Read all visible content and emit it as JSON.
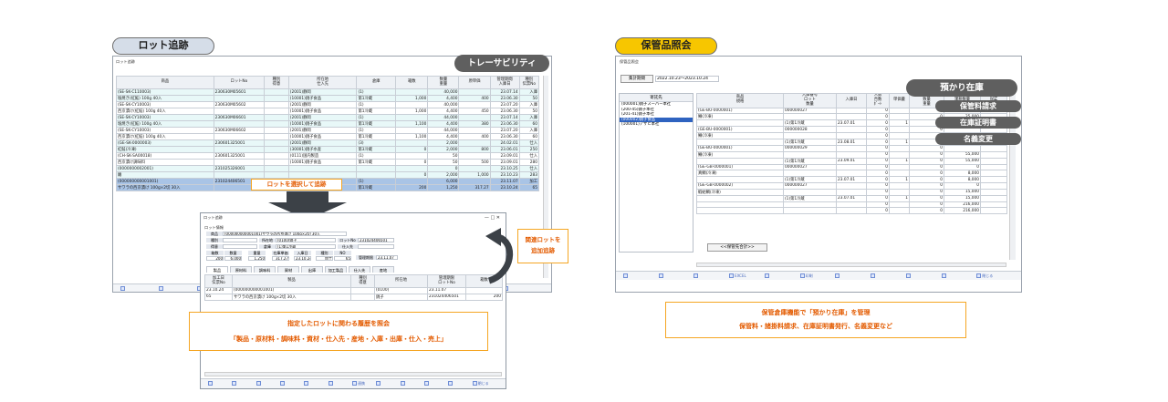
{
  "left": {
    "section_label": "ロット追跡",
    "window_title": "ロット追跡",
    "overlay_label": "トレーサビリティ",
    "columns": [
      "商品",
      "ロットNo",
      "種別\n得意",
      "所在地\n仕入先",
      "倉庫",
      "箱数",
      "数量\n重量",
      "原単価",
      "管理期間\n入庫日",
      "種別\n伝票No"
    ],
    "rows": [
      [
        "(SE-SK-C110003)",
        "230630M05601",
        "",
        "(2001)静岡",
        "(1)",
        "",
        "40,000",
        "",
        "23.07.14",
        "入庫"
      ],
      [
        "塩焼き(紅鮭) 100g 40入",
        "",
        "",
        "(10001)銚子食品",
        "第1冷蔵",
        "1,000",
        "4,400",
        "400",
        "23.06.30",
        "50"
      ],
      [
        "(SE-SK-CY10003)",
        "230630M05602",
        "",
        "(2001)静岡",
        "(1)",
        "",
        "40,000",
        "",
        "23.07.20",
        "入庫"
      ],
      [
        "西京漬け(紅鮭) 100g 40入",
        "",
        "",
        "(10001)銚子食品",
        "第1冷蔵",
        "1,000",
        "4,400",
        "450",
        "23.06.30",
        "50"
      ],
      [
        "(SE-SK-CY10003)",
        "230630M06601",
        "",
        "(2001)静岡",
        "(1)",
        "",
        "44,000",
        "",
        "23.07.14",
        "入庫"
      ],
      [
        "塩焼き(紅鮭) 100g 40入",
        "",
        "",
        "(10001)銚子食品",
        "第1冷蔵",
        "1,100",
        "4,400",
        "380",
        "23.06.30",
        "60"
      ],
      [
        "(SE-SK-CY10003)",
        "230630M06602",
        "",
        "(2001)静岡",
        "(1)",
        "",
        "44,000",
        "",
        "23.07.20",
        "入庫"
      ],
      [
        "西京漬け(紅鮭) 100g 40入",
        "",
        "",
        "(10001)銚子食品",
        "第1冷蔵",
        "1,100",
        "4,400",
        "400",
        "23.06.30",
        "60"
      ],
      [
        "(GE-SK-0000003)",
        "230601325001",
        "",
        "(2001)静岡",
        "(3)",
        "",
        "2,000",
        "",
        "24.02.01",
        "仕入"
      ],
      [
        "紅鮭(冷凍)",
        "",
        "",
        "(30001)銚子水産",
        "第3冷蔵",
        "0",
        "2,000",
        "800",
        "23.06.01",
        "250"
      ],
      [
        "(CH-SK-SA00018)",
        "230601325001",
        "",
        "(0111)国内製造",
        "(1)",
        "",
        "50",
        "",
        "23.09.01",
        "仕入"
      ],
      [
        "西京漬け調味料",
        "",
        "",
        "(10001)銚子食品",
        "第1冷蔵",
        "0",
        "50",
        "500",
        "23.09.01",
        "280"
      ],
      [
        "(0000000002001)",
        "231025326001",
        "",
        "",
        "",
        "",
        "0",
        "",
        "23.10.25",
        "仕入"
      ],
      [
        "鰆",
        "",
        "",
        "",
        "",
        "0",
        "2,000",
        "1,000",
        "23.10.23",
        "283"
      ],
      [
        "(000000000001001)",
        "231024406501",
        "",
        "",
        "(1)",
        "",
        "6,000",
        "",
        "23.11.07",
        "加工"
      ],
      [
        "サワラの西京漬け 100g×2切 30入",
        "",
        "",
        "",
        "第1冷蔵",
        "200",
        "1,250",
        "317.27",
        "23.10.24",
        "65"
      ]
    ],
    "select_callout": "ロットを選択して追跡",
    "related_callout": "関連ロットを\n追加追跡",
    "detail": {
      "title": "ロット追跡",
      "controls": "—   □   ✕",
      "header_label": "ロット情報",
      "product_label": "商品",
      "product_value": "(000000000001001)サワラの西京漬け 100g×2切 30入",
      "kind_label": "種別",
      "location_label": "所在地",
      "location_value": "(0100)銚子",
      "lot_label": "ロットNo",
      "lot_value": "231024406501",
      "customer_label": "得意",
      "warehouse_label": "倉庫",
      "warehouse_value": "(1)第1冷蔵",
      "supplier_label": "仕入先",
      "sum_headers": [
        "箱数",
        "数量",
        "重量",
        "在庫単価",
        "入庫日",
        "種別",
        "NO"
      ],
      "sum_values": [
        "200",
        "6,000",
        "1,250",
        "317.27",
        "23.10.24",
        "加工",
        "65"
      ],
      "manage_label": "管理期限",
      "manage_value": "23.11.07",
      "tabs": [
        "製品",
        "原材料",
        "調味料",
        "資材",
        "出庫",
        "加工製品",
        "仕入先",
        "産地"
      ],
      "cols": [
        "加工日\n伝票No",
        "製品",
        "種別\n得意",
        "所在地",
        "管理期限\nロットNo",
        "箱数"
      ],
      "row1": [
        "23.10.24",
        "(000000000001001)",
        "",
        "(0100)",
        "23.11.07",
        ""
      ],
      "row2": [
        "65",
        "サワラの西京漬け 100g×2切 30入",
        "",
        "銚子",
        "231024406501",
        "200"
      ],
      "fkeys": [
        "",
        "",
        "",
        "",
        "",
        "",
        "連携",
        "",
        "",
        "",
        "",
        "閉じる"
      ]
    },
    "bottom_callout": {
      "line1": "指定したロットに関わる履歴を照会",
      "line2": "「製品・原材料・調味料・資材・仕入先・産地・入庫・出庫・仕入・売上」"
    },
    "fkeys": [
      "",
      "",
      "",
      "",
      "",
      "",
      "",
      "",
      "",
      "",
      ""
    ]
  },
  "right": {
    "section_label": "保管品照会",
    "window_title": "保管品照会",
    "overlay_label": "預かり在庫",
    "tag1": "保管料請求",
    "tag2": "在庫証明書",
    "tag3": "名義変更",
    "period_button": "集計期間",
    "period_value": "2022.10.23〜2023.10.24",
    "owners_header": "寄託先",
    "owners": [
      "(000001)銚子スーパー本社",
      "(200-45)銚子本社",
      "(201-41)銚子本社",
      "(000002)銚子食品",
      "(100001)アサヒ本社"
    ],
    "columns": [
      "商品\n規格",
      "入庫番号\nロット\n数量",
      "入庫日",
      "入数\n合数\nﾎﾞｰﾄ",
      "単価量",
      "元入庫箱数\n数量\n重量",
      "課税数量",
      "出庫\n箱数"
    ],
    "rows": [
      [
        "(GE-BU-0000001)",
        "000000027",
        "",
        "0",
        "",
        "0",
        "",
        ""
      ],
      [
        "鯖(冷凍)",
        "",
        "",
        "0",
        "",
        "0",
        "25,000",
        ""
      ],
      [
        "",
        "(1)第1冷蔵",
        "23.07.01",
        "0",
        "1",
        "0",
        "25,000",
        ""
      ],
      [
        "(GE-BU-0000001)",
        "000000028",
        "",
        "0",
        "",
        "0",
        "",
        ""
      ],
      [
        "鯖(冷凍)",
        "",
        "",
        "0",
        "",
        "0",
        "25,000",
        ""
      ],
      [
        "",
        "(1)第1冷蔵",
        "23.08.01",
        "0",
        "1",
        "0",
        "25,000",
        ""
      ],
      [
        "(GE-BU-0000001)",
        "000000029",
        "",
        "0",
        "",
        "0",
        "",
        ""
      ],
      [
        "鯖(冷凍)",
        "",
        "",
        "0",
        "",
        "0",
        "55,000",
        ""
      ],
      [
        "",
        "(1)第1冷蔵",
        "23.09.01",
        "0",
        "1",
        "0",
        "55,000",
        ""
      ],
      [
        "(GE-GB-0000001)",
        "000000027",
        "",
        "0",
        "",
        "0",
        "0",
        ""
      ],
      [
        "真鯛(冷凍)",
        "",
        "",
        "0",
        "",
        "0",
        "8,000",
        ""
      ],
      [
        "",
        "(1)第1冷蔵",
        "23.07.01",
        "0",
        "1",
        "0",
        "8,000",
        ""
      ],
      [
        "(GE-GB-0000002)",
        "000000027",
        "",
        "0",
        "",
        "0",
        "0",
        ""
      ],
      [
        "蝦蛄鯛(冷凍)",
        "",
        "",
        "0",
        "",
        "0",
        "15,000",
        ""
      ],
      [
        "",
        "(1)第1冷蔵",
        "23.07.01",
        "0",
        "1",
        "0",
        "15,000",
        ""
      ],
      [
        "",
        "",
        "",
        "0",
        "",
        "0",
        "216,000",
        ""
      ],
      [
        "",
        "",
        "",
        "0",
        "",
        "0",
        "216,000",
        ""
      ]
    ],
    "summary_button": "<<保管先合計>>",
    "fkeys": [
      "",
      "",
      "",
      "EXCEL",
      "",
      "印刷",
      "",
      "",
      "",
      "",
      "閉じる"
    ],
    "caption": {
      "line1": "保管倉庫機能で「預かり在庫」を管理",
      "line2": "保管料・諸掛料請求、在庫証明書発行、名義変更など"
    }
  },
  "colors": {
    "left_pill": "#d5dde8",
    "right_pill": "#f7c600",
    "overlay": "#5f5f5f",
    "callout_border": "#f5a623",
    "callout_text": "#e35b00",
    "arrow": "#3c4147",
    "selected_row": "#a9c4e6"
  }
}
